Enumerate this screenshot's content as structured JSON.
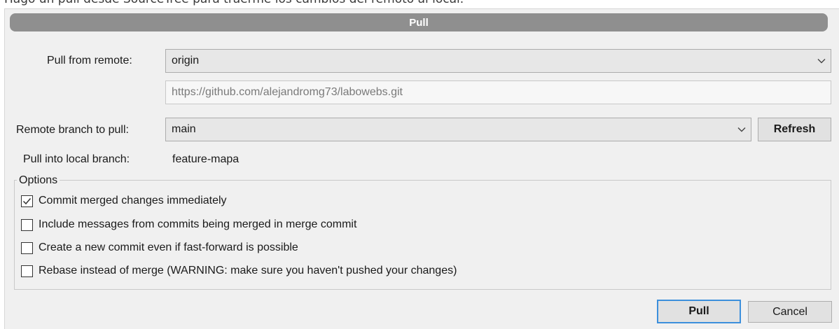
{
  "caption": "Hago un pull desde SourceTree para traerme los cambios del remoto al local.",
  "dialog": {
    "title": "Pull",
    "pull_from_remote_label": "Pull from remote:",
    "remote_value": "origin",
    "remote_url": "https://github.com/alejandromg73/labowebs.git",
    "remote_branch_label": "Remote branch to pull:",
    "remote_branch_value": "main",
    "refresh_label": "Refresh",
    "local_branch_label": "Pull into local branch:",
    "local_branch_value": "feature-mapa",
    "options_legend": "Options",
    "options": [
      {
        "label": "Commit merged changes immediately",
        "checked": true
      },
      {
        "label": "Include messages from commits being merged in merge commit",
        "checked": false
      },
      {
        "label": "Create a new commit even if fast-forward is possible",
        "checked": false
      },
      {
        "label": "Rebase instead of merge (WARNING: make sure you haven't pushed your changes)",
        "checked": false
      }
    ],
    "pull_button": "Pull",
    "cancel_button": "Cancel"
  },
  "colors": {
    "title_bar": "#8f8f8f",
    "default_button_border": "#3c8fdc",
    "dialog_bg": "#f0f0f0"
  }
}
